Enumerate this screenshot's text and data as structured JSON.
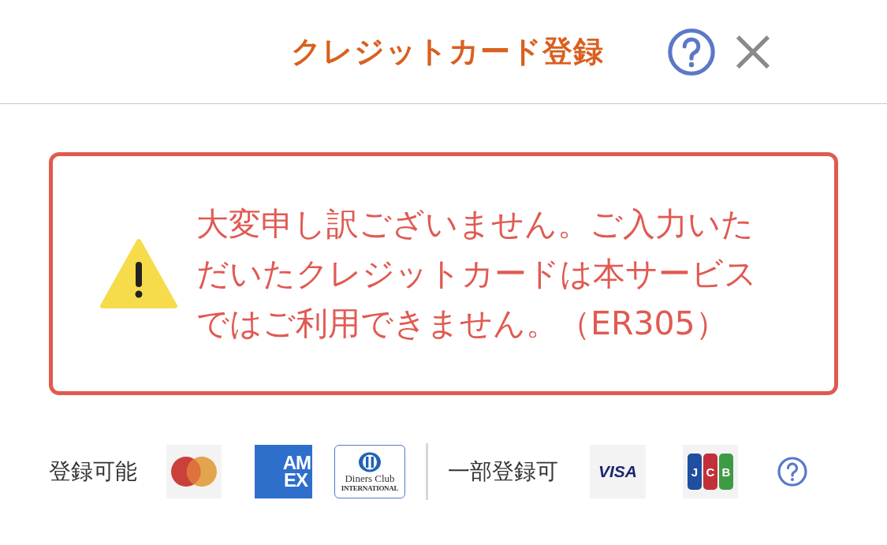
{
  "header": {
    "title": "クレジットカード登録"
  },
  "error": {
    "message": "大変申し訳ございません。ご入力いただいたクレジットカードは本サービスではご利用できません。（ER305）"
  },
  "card_groups": [
    {
      "label": "登録可能",
      "cards": [
        {
          "kind": "mastercard"
        },
        {
          "kind": "amex",
          "texts": [
            "AM",
            "EX"
          ]
        },
        {
          "kind": "diners",
          "texts": [
            "Diners Club",
            "INTERNATIONAL"
          ]
        }
      ]
    },
    {
      "label": "一部登録可",
      "cards": [
        {
          "kind": "visa",
          "texts": [
            "VISA"
          ]
        },
        {
          "kind": "jcb",
          "texts": [
            "J",
            "C",
            "B"
          ]
        }
      ]
    }
  ]
}
